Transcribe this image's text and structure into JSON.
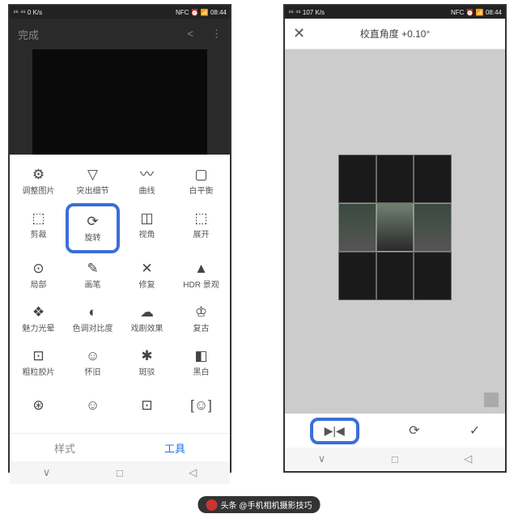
{
  "status": {
    "left": "⁴⁶ ⁴⁶ 0 K/s",
    "right": "NFC ⏰ 📶 08:44",
    "left2": "⁴⁶ ⁴⁶ 107 K/s",
    "right2": "NFC ⏰ 📶 08:44"
  },
  "p1": {
    "done": "完成",
    "share": "<",
    "more": "⋮",
    "tools": [
      {
        "ic": "⚙",
        "lb": "调整图片"
      },
      {
        "ic": "▽",
        "lb": "突出细节"
      },
      {
        "ic": "〰",
        "lb": "曲线"
      },
      {
        "ic": "▢",
        "lb": "白平衡"
      },
      {
        "ic": "⬚",
        "lb": "剪裁"
      },
      {
        "ic": "⟳",
        "lb": "旋转",
        "hl": true
      },
      {
        "ic": "◫",
        "lb": "视角"
      },
      {
        "ic": "⬚",
        "lb": "展开"
      },
      {
        "ic": "⊙",
        "lb": "局部"
      },
      {
        "ic": "✎",
        "lb": "画笔"
      },
      {
        "ic": "✕",
        "lb": "修复"
      },
      {
        "ic": "▲",
        "lb": "HDR 景观"
      },
      {
        "ic": "❖",
        "lb": "魅力光晕"
      },
      {
        "ic": "◐",
        "lb": "色调对比度"
      },
      {
        "ic": "☁",
        "lb": "戏剧效果"
      },
      {
        "ic": "♔",
        "lb": "复古"
      },
      {
        "ic": "⊡",
        "lb": "粗粒胶片"
      },
      {
        "ic": "☺",
        "lb": "怀旧"
      },
      {
        "ic": "✱",
        "lb": "斑驳"
      },
      {
        "ic": "◧",
        "lb": "黑白"
      },
      {
        "ic": "⊛",
        "lb": ""
      },
      {
        "ic": "☺",
        "lb": ""
      },
      {
        "ic": "⊡",
        "lb": ""
      },
      {
        "ic": "[☺]",
        "lb": ""
      }
    ],
    "tab1": "样式",
    "tab2": "工具"
  },
  "p2": {
    "title": "校直角度 +0.10°",
    "x": "✕",
    "flip": "▶|◀",
    "rot": "⟳",
    "ok": "✓"
  },
  "nav": {
    "a": "∨",
    "b": "□",
    "c": "◁"
  },
  "credit": "头条 @手机相机摄影技巧"
}
